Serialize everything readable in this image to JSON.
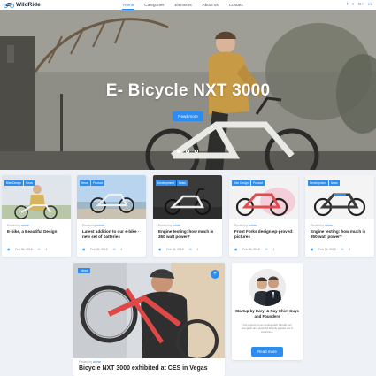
{
  "header": {
    "logo_text": "WildRide",
    "nav": [
      {
        "label": "Home",
        "active": true
      },
      {
        "label": "Categories",
        "active": false
      },
      {
        "label": "Elements",
        "active": false
      },
      {
        "label": "About us",
        "active": false
      },
      {
        "label": "Contact",
        "active": false
      }
    ],
    "social_icons": [
      "facebook-icon",
      "twitter-icon",
      "google-plus-icon",
      "linkedin-icon"
    ],
    "social_glyphs": [
      "f",
      "t",
      "G+",
      "in"
    ]
  },
  "hero": {
    "title": "E- Bicycle NXT 3000",
    "button_label": "Read more",
    "slides_total": 3,
    "active_slide": 1
  },
  "colors": {
    "accent": "#2d8cf0"
  },
  "cards": [
    {
      "tags": [
        "Bike Design",
        "News"
      ],
      "posted_prefix": "Posted by",
      "author": "admin",
      "title": "E-bike, a Beautiful Design",
      "date": "Feb 06, 2018",
      "comments": "4"
    },
    {
      "tags": [
        "News",
        "Product"
      ],
      "posted_prefix": "Posted by",
      "author": "admin",
      "title": "Latest addition to our e-bike - new set of batteries",
      "date": "Feb 06, 2018",
      "comments": "4"
    },
    {
      "tags": [
        "Development",
        "News"
      ],
      "posted_prefix": "Posted by",
      "author": "admin",
      "title": "Engine testing: how much is 350 watt power?",
      "date": "Feb 06, 2018",
      "comments": "4"
    },
    {
      "tags": [
        "Bike Design",
        "Product"
      ],
      "posted_prefix": "Posted by",
      "author": "admin",
      "title": "Front Forks design ep-proved: pictures",
      "date": "Feb 06, 2018",
      "comments": "1"
    },
    {
      "tags": [
        "Development",
        "News"
      ],
      "posted_prefix": "Posted by",
      "author": "admin",
      "title": "Engine testing: how much is 350 watt power?",
      "date": "Feb 06, 2018",
      "comments": "4"
    }
  ],
  "featured": {
    "tag": "News",
    "posted_prefix": "Posted by",
    "author": "admin",
    "title": "Bicycle NXT 3000 exhibited at CES in Vegas"
  },
  "about": {
    "title": "Startup by Daryl & Ray Chief Guys and Founders",
    "description": "Our journey to an ecologically friendly yet energetic and powerful bicycle started out in Antarctica.",
    "button_label": "Read more"
  }
}
